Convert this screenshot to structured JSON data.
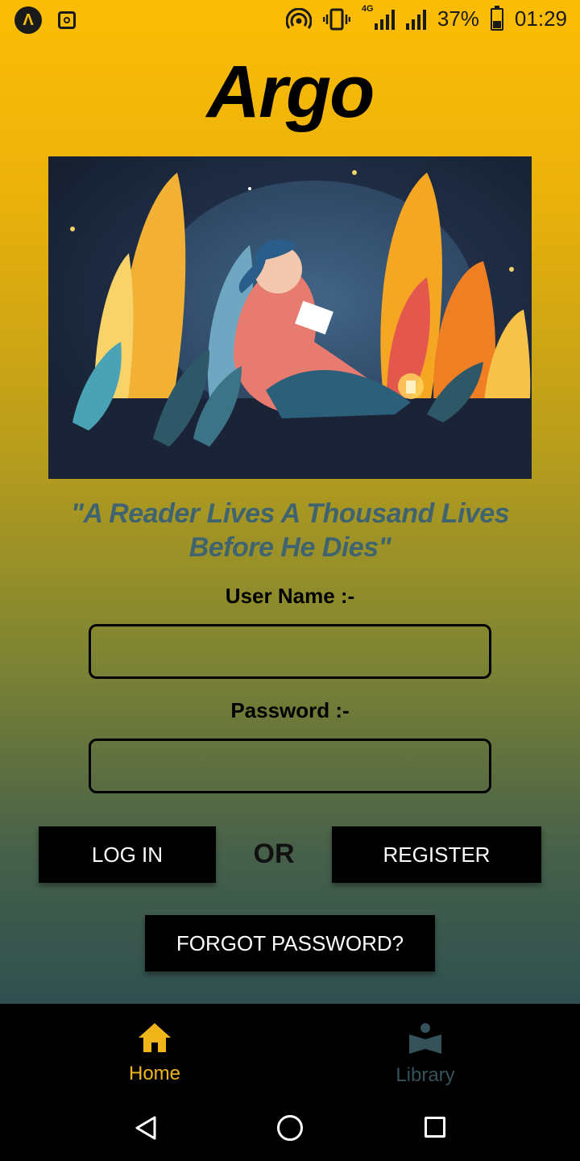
{
  "status_bar": {
    "battery_percent": "37%",
    "time": "01:29",
    "network": "4G"
  },
  "app": {
    "title": "Argo",
    "quote": "\"A Reader Lives A Thousand Lives Before He Dies\""
  },
  "form": {
    "username_label": "User Name :-",
    "username_value": "",
    "password_label": "Password :-",
    "password_value": ""
  },
  "buttons": {
    "login": "LOG IN",
    "or": "OR",
    "register": "REGISTER",
    "forgot": "FORGOT PASSWORD?"
  },
  "bottom_nav": {
    "items": [
      {
        "label": "Home",
        "icon": "home-icon",
        "active": true
      },
      {
        "label": "Library",
        "icon": "library-icon",
        "active": false
      }
    ]
  },
  "colors": {
    "accent": "#fcbd05",
    "inactive_nav": "#35515a",
    "quote": "#3f6470"
  }
}
